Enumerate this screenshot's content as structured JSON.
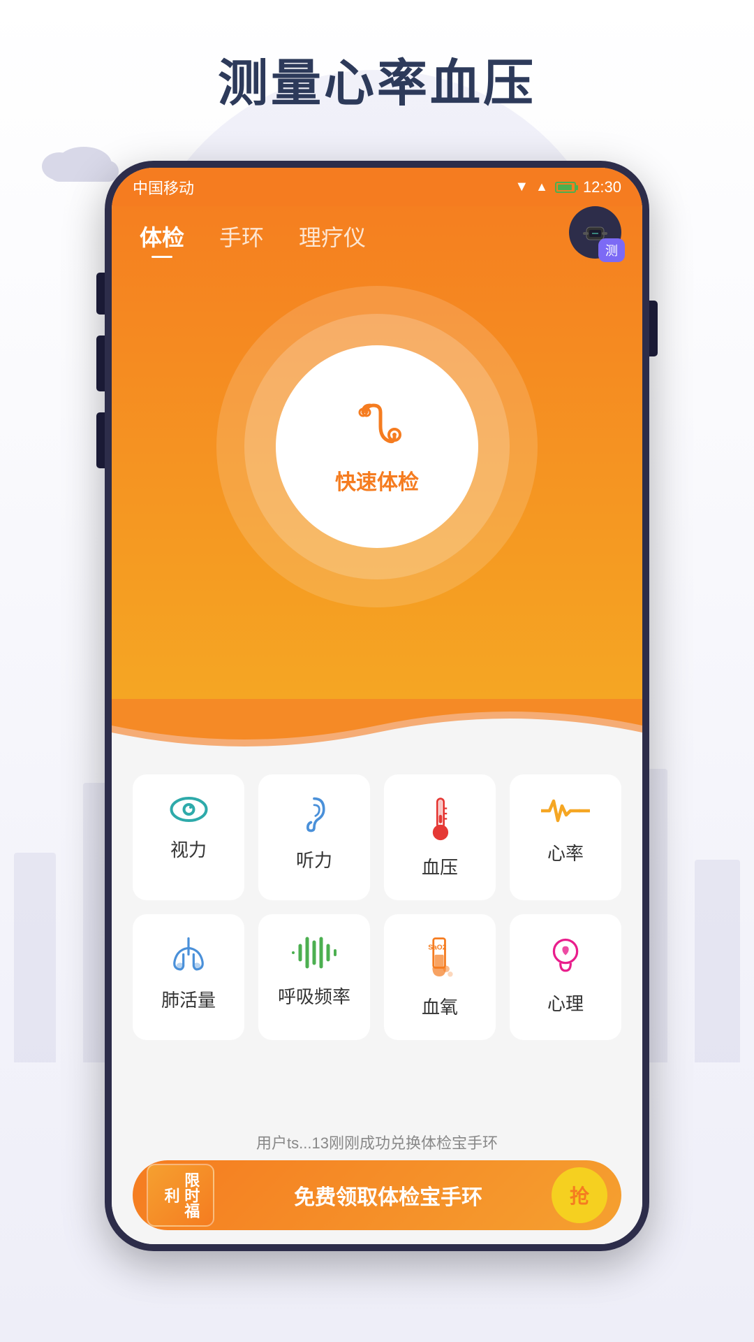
{
  "page": {
    "title": "测量心率血压",
    "background_color": "#f0f0f8"
  },
  "status_bar": {
    "carrier": "中国移动",
    "time": "12:30"
  },
  "nav": {
    "tabs": [
      {
        "id": "exam",
        "label": "体检",
        "active": true
      },
      {
        "id": "bracelet",
        "label": "手环",
        "active": false
      },
      {
        "id": "therapy",
        "label": "理疗仪",
        "active": false
      }
    ]
  },
  "device_badge": {
    "label": "测"
  },
  "center_button": {
    "icon": "stethoscope",
    "label": "快速体检"
  },
  "health_items": [
    {
      "id": "vision",
      "label": "视力",
      "icon": "eye",
      "color": "#2eaaaa"
    },
    {
      "id": "hearing",
      "label": "听力",
      "icon": "ear",
      "color": "#4a90d9"
    },
    {
      "id": "blood_pressure",
      "label": "血压",
      "icon": "thermometer",
      "color": "#e53935"
    },
    {
      "id": "heart_rate",
      "label": "心率",
      "icon": "heartrate",
      "color": "#f5a623"
    },
    {
      "id": "lung",
      "label": "肺活量",
      "icon": "lung",
      "color": "#4a90d9"
    },
    {
      "id": "breath",
      "label": "呼吸频率",
      "icon": "breath",
      "color": "#4caf50"
    },
    {
      "id": "oxygen",
      "label": "血氧",
      "icon": "oxygen",
      "color": "#f57c20"
    },
    {
      "id": "psychology",
      "label": "心理",
      "icon": "brain",
      "color": "#e91e8c"
    }
  ],
  "scroll_notice": {
    "text": "用户ts...13刚刚成功兑换体检宝手环"
  },
  "banner": {
    "tag": "限时福利",
    "text": "免费领取体检宝手环",
    "button_label": "抢"
  }
}
